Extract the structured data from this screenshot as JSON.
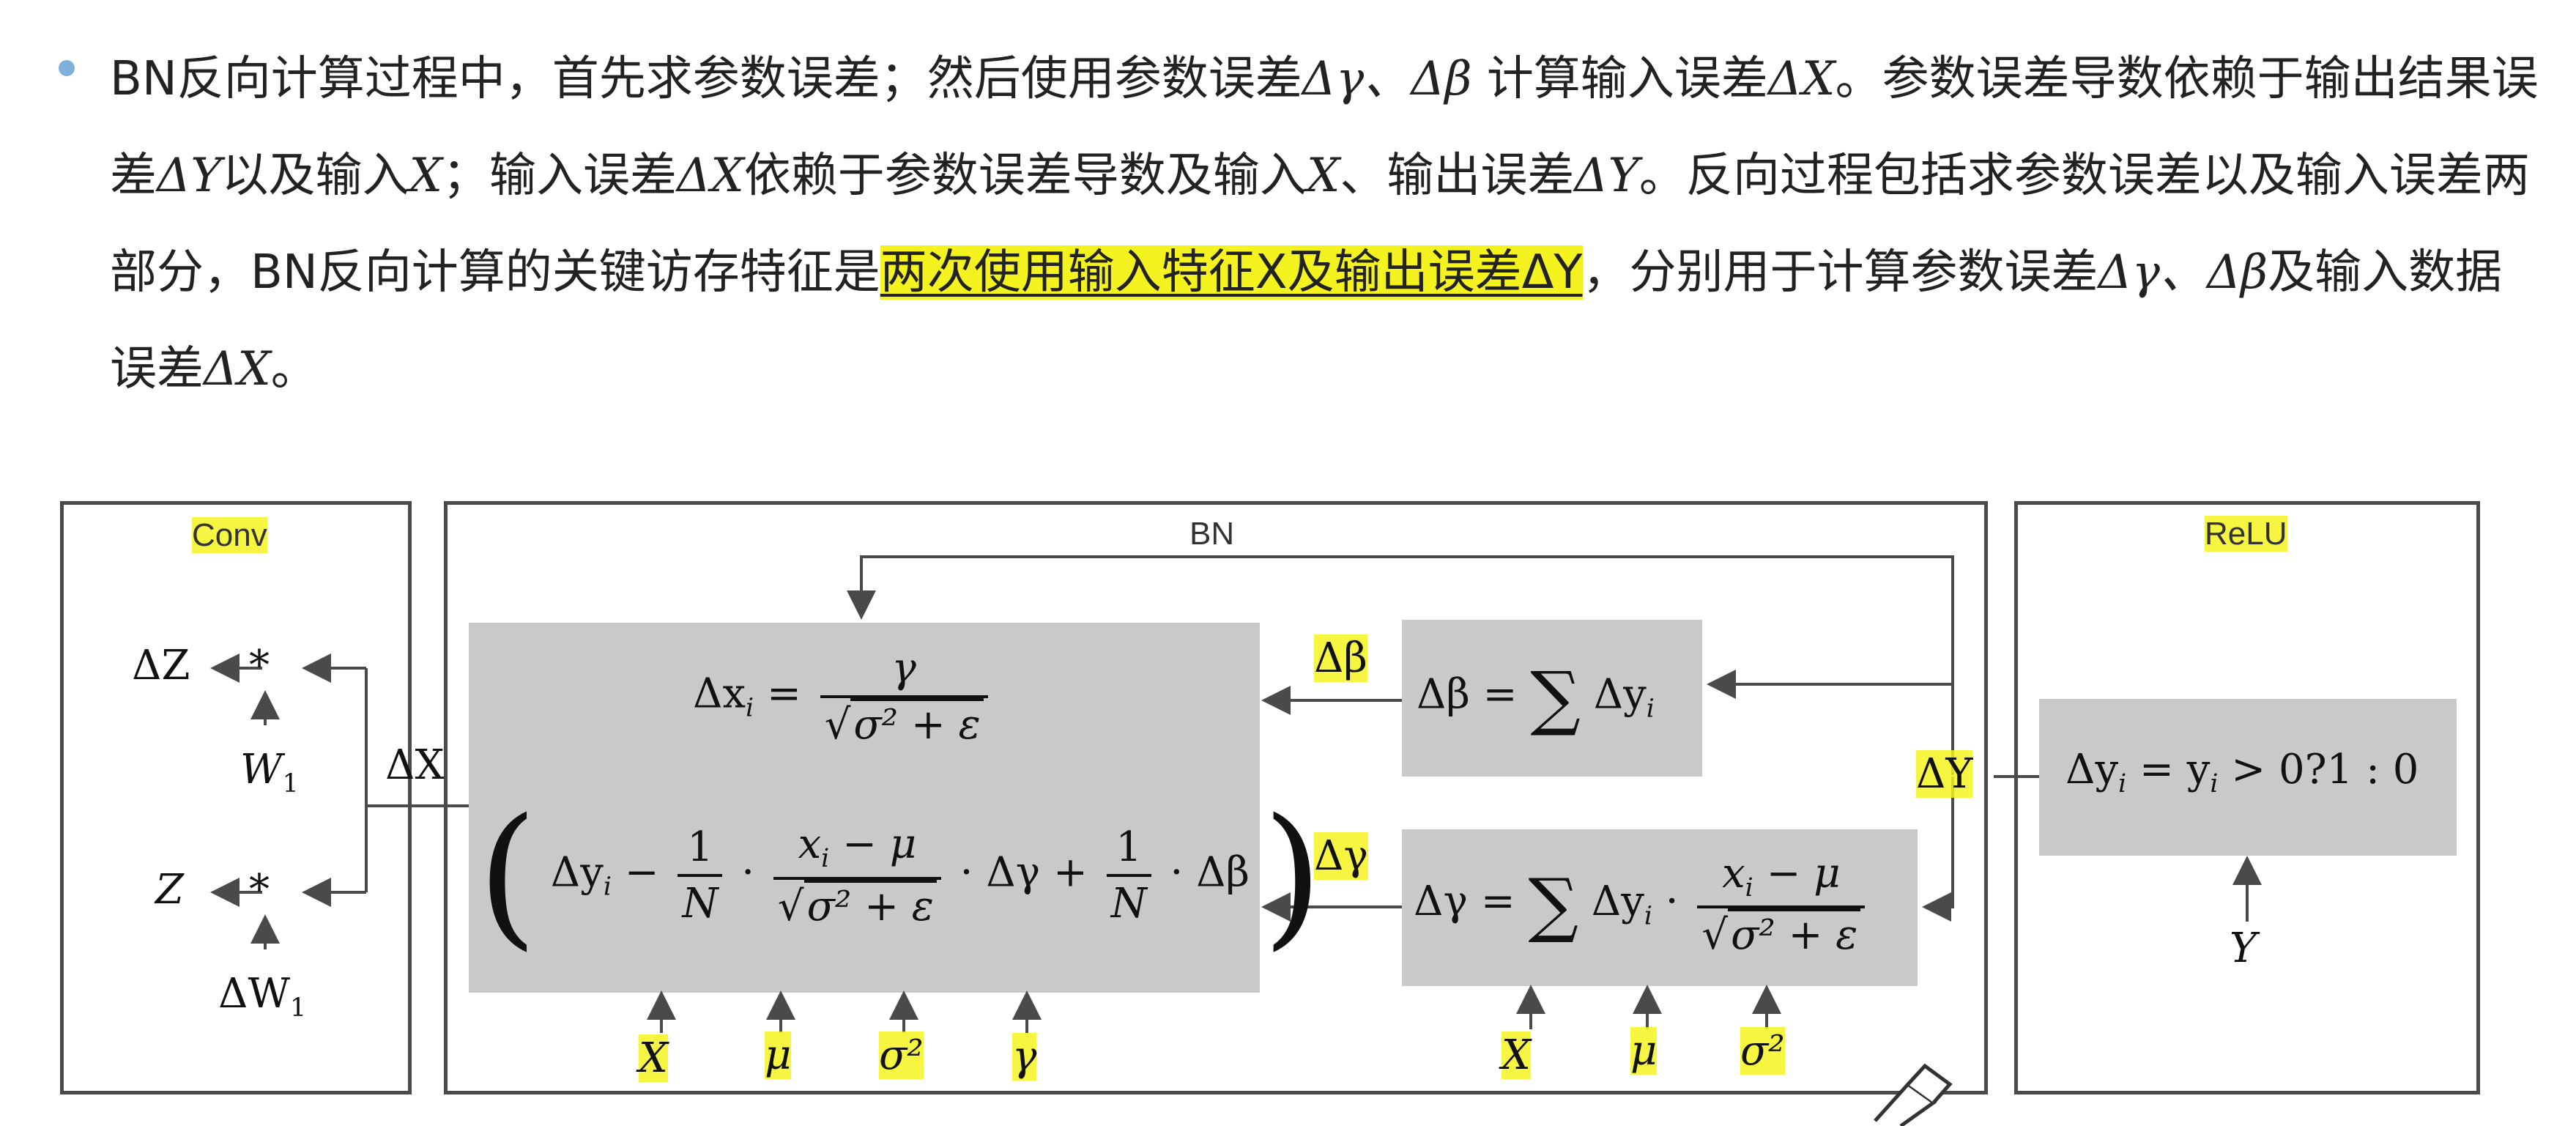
{
  "paragraph": {
    "seg1": "BN反向计算过程中，首先求参数误差；然后使用参数误差",
    "seg2": "Δγ、Δβ",
    "seg3": " 计算输入误差",
    "seg4": "ΔX",
    "seg5": "。参数误差导数依赖于输出结果误差",
    "seg6": "ΔY",
    "seg7": "以及输入",
    "seg8": "X",
    "seg9": "；输入误差",
    "seg10": "ΔX",
    "seg11": "依赖于参数误差导数及输入",
    "seg12": "X",
    "seg13": "、输出误差",
    "seg14": "ΔY",
    "seg15": "。反向过程包括求参数误差以及输入误差两部分，BN反向计算的关键访存特征是",
    "highlight": "两次使用输入特征X及输出误差ΔY",
    "seg16": "，分别用于计算参数误差",
    "seg17": "Δγ、Δβ",
    "seg18": "及输入数据误差",
    "seg19": "ΔX",
    "seg20": "。"
  },
  "diagram": {
    "conv": {
      "label": "Conv",
      "dz": "ΔZ",
      "star1": "*",
      "w1": "W",
      "w1_sub": "1",
      "z": "Z",
      "star2": "*",
      "dw1": "ΔW",
      "dw1_sub": "1",
      "arrow1": "←",
      "arrow2": "←"
    },
    "dx_label": "ΔX",
    "bn": {
      "label": "BN",
      "dx_lhs": "Δx",
      "dx_lhs_sub": "i",
      "eq": "=",
      "gamma_num": "γ",
      "sqrt_den": "σ² + ε",
      "dyi": "Δy",
      "dyi_sub": "i",
      "minus1": "−",
      "one1": "1",
      "n1": "N",
      "dot": "·",
      "xmu": "x",
      "xmu_sub": "i",
      "xmu_rest": " − μ",
      "sqrt2": "σ² + ε",
      "dgamma": "· Δγ +",
      "one2": "1",
      "n2": "N",
      "dbeta": "· Δβ",
      "lparen": "(",
      "rparen": ")",
      "inputs": [
        "X",
        "μ",
        "σ²",
        "γ"
      ],
      "dbeta_tag": "Δβ",
      "dgamma_tag": "Δγ",
      "dbeta_eq_lhs": "Δβ =",
      "sum": "∑",
      "dbeta_eq_rhs": "Δy",
      "dbeta_eq_sub": "i",
      "dgamma_eq_lhs": "Δγ =",
      "dgamma_eq_mid": "Δy",
      "dgamma_eq_mid_sub": "i",
      "dgamma_dot": "·",
      "dgamma_num": "x",
      "dgamma_num_sub": "i",
      "dgamma_num_rest": " − μ",
      "dgamma_den": "σ² + ε",
      "param_inputs": [
        "X",
        "μ",
        "σ²"
      ],
      "dy_tag": "ΔY"
    },
    "relu": {
      "label": "ReLU",
      "eq": "Δy",
      "eq_sub": "i",
      "eq_mid": " = y",
      "eq_mid_sub": "i",
      "eq_rest": " > 0?1 : 0",
      "y": "Y"
    }
  }
}
